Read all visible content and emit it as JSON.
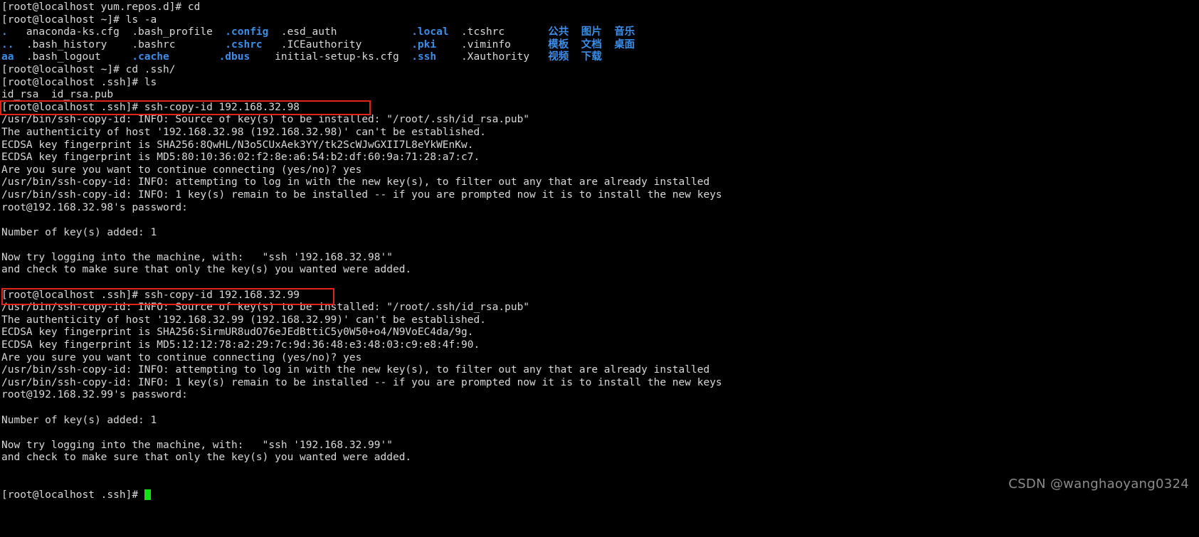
{
  "terminal": {
    "colors": {
      "background": "#000000",
      "foreground": "#d8d8d8",
      "directory": "#3b8eea",
      "cursor": "#15e015",
      "highlight_box": "#e2231a",
      "watermark": "#8c8c8c"
    },
    "lines": [
      {
        "id": "l01",
        "text": "[root@localhost yum.repos.d]# cd"
      },
      {
        "id": "l02",
        "text": "[root@localhost ~]# ls -a"
      },
      {
        "id": "l03",
        "segments": [
          {
            "text": ".",
            "style": "dir"
          },
          {
            "text": "   anaconda-ks.cfg  .bash_profile  "
          },
          {
            "text": ".config",
            "style": "dir"
          },
          {
            "text": "  .esd_auth            "
          },
          {
            "text": ".local",
            "style": "dir"
          },
          {
            "text": "  .tcshrc       "
          },
          {
            "text": "公共",
            "style": "cn"
          },
          {
            "text": "  "
          },
          {
            "text": "图片",
            "style": "cn"
          },
          {
            "text": "  "
          },
          {
            "text": "音乐",
            "style": "cn"
          }
        ]
      },
      {
        "id": "l04",
        "segments": [
          {
            "text": "..",
            "style": "dir"
          },
          {
            "text": "  .bash_history    .bashrc        "
          },
          {
            "text": ".cshrc",
            "style": "dir"
          },
          {
            "text": "   .ICEauthority        "
          },
          {
            "text": ".pki",
            "style": "dir"
          },
          {
            "text": "    .viminfo      "
          },
          {
            "text": "模板",
            "style": "cn"
          },
          {
            "text": "  "
          },
          {
            "text": "文档",
            "style": "cn"
          },
          {
            "text": "  "
          },
          {
            "text": "桌面",
            "style": "cn"
          }
        ]
      },
      {
        "id": "l05",
        "segments": [
          {
            "text": "aa",
            "style": "dir"
          },
          {
            "text": "  .bash_logout     "
          },
          {
            "text": ".cache",
            "style": "dir"
          },
          {
            "text": "        "
          },
          {
            "text": ".dbus",
            "style": "dir"
          },
          {
            "text": "    initial-setup-ks.cfg  "
          },
          {
            "text": ".ssh",
            "style": "dir"
          },
          {
            "text": "    .Xauthority   "
          },
          {
            "text": "视频",
            "style": "cn"
          },
          {
            "text": "  "
          },
          {
            "text": "下载",
            "style": "cn"
          }
        ]
      },
      {
        "id": "l06",
        "text": "[root@localhost ~]# cd .ssh/"
      },
      {
        "id": "l07",
        "text": "[root@localhost .ssh]# ls"
      },
      {
        "id": "l08",
        "text": "id_rsa  id_rsa.pub"
      },
      {
        "id": "l09",
        "text": "[root@localhost .ssh]# ssh-copy-id 192.168.32.98"
      },
      {
        "id": "l10",
        "text": "/usr/bin/ssh-copy-id: INFO: Source of key(s) to be installed: \"/root/.ssh/id_rsa.pub\""
      },
      {
        "id": "l11",
        "text": "The authenticity of host '192.168.32.98 (192.168.32.98)' can't be established."
      },
      {
        "id": "l12",
        "text": "ECDSA key fingerprint is SHA256:8QwHL/N3o5CUxAek3YY/tk2ScWJwGXII7L8eYkWEnKw."
      },
      {
        "id": "l13",
        "text": "ECDSA key fingerprint is MD5:80:10:36:02:f2:8e:a6:54:b2:df:60:9a:71:28:a7:c7."
      },
      {
        "id": "l14",
        "text": "Are you sure you want to continue connecting (yes/no)? yes"
      },
      {
        "id": "l15",
        "text": "/usr/bin/ssh-copy-id: INFO: attempting to log in with the new key(s), to filter out any that are already installed"
      },
      {
        "id": "l16",
        "text": "/usr/bin/ssh-copy-id: INFO: 1 key(s) remain to be installed -- if you are prompted now it is to install the new keys"
      },
      {
        "id": "l17",
        "text": "root@192.168.32.98's password:"
      },
      {
        "id": "l18",
        "text": ""
      },
      {
        "id": "l19",
        "text": "Number of key(s) added: 1"
      },
      {
        "id": "l20",
        "text": ""
      },
      {
        "id": "l21",
        "text": "Now try logging into the machine, with:   \"ssh '192.168.32.98'\""
      },
      {
        "id": "l22",
        "text": "and check to make sure that only the key(s) you wanted were added."
      },
      {
        "id": "l23",
        "text": ""
      },
      {
        "id": "l24",
        "text": "[root@localhost .ssh]# ssh-copy-id 192.168.32.99"
      },
      {
        "id": "l25",
        "text": "/usr/bin/ssh-copy-id: INFO: Source of key(s) to be installed: \"/root/.ssh/id_rsa.pub\""
      },
      {
        "id": "l26",
        "text": "The authenticity of host '192.168.32.99 (192.168.32.99)' can't be established."
      },
      {
        "id": "l27",
        "text": "ECDSA key fingerprint is SHA256:SirmUR8udO76eJEdBttiC5y0W50+o4/N9VoEC4da/9g."
      },
      {
        "id": "l28",
        "text": "ECDSA key fingerprint is MD5:12:12:78:a2:29:7c:9d:36:48:e3:48:03:c9:e8:4f:90."
      },
      {
        "id": "l29",
        "text": "Are you sure you want to continue connecting (yes/no)? yes"
      },
      {
        "id": "l30",
        "text": "/usr/bin/ssh-copy-id: INFO: attempting to log in with the new key(s), to filter out any that are already installed"
      },
      {
        "id": "l31",
        "text": "/usr/bin/ssh-copy-id: INFO: 1 key(s) remain to be installed -- if you are prompted now it is to install the new keys"
      },
      {
        "id": "l32",
        "text": "root@192.168.32.99's password:"
      },
      {
        "id": "l33",
        "text": ""
      },
      {
        "id": "l34",
        "text": "Number of key(s) added: 1"
      },
      {
        "id": "l35",
        "text": ""
      },
      {
        "id": "l36",
        "text": "Now try logging into the machine, with:   \"ssh '192.168.32.99'\""
      },
      {
        "id": "l37",
        "text": "and check to make sure that only the key(s) you wanted were added."
      },
      {
        "id": "l38",
        "text": ""
      },
      {
        "id": "l39",
        "text": ""
      },
      {
        "id": "l40",
        "prompt": "[root@localhost .ssh]# ",
        "cursor": true
      }
    ]
  },
  "watermark": {
    "text": "CSDN @wanghaoyang0324"
  }
}
